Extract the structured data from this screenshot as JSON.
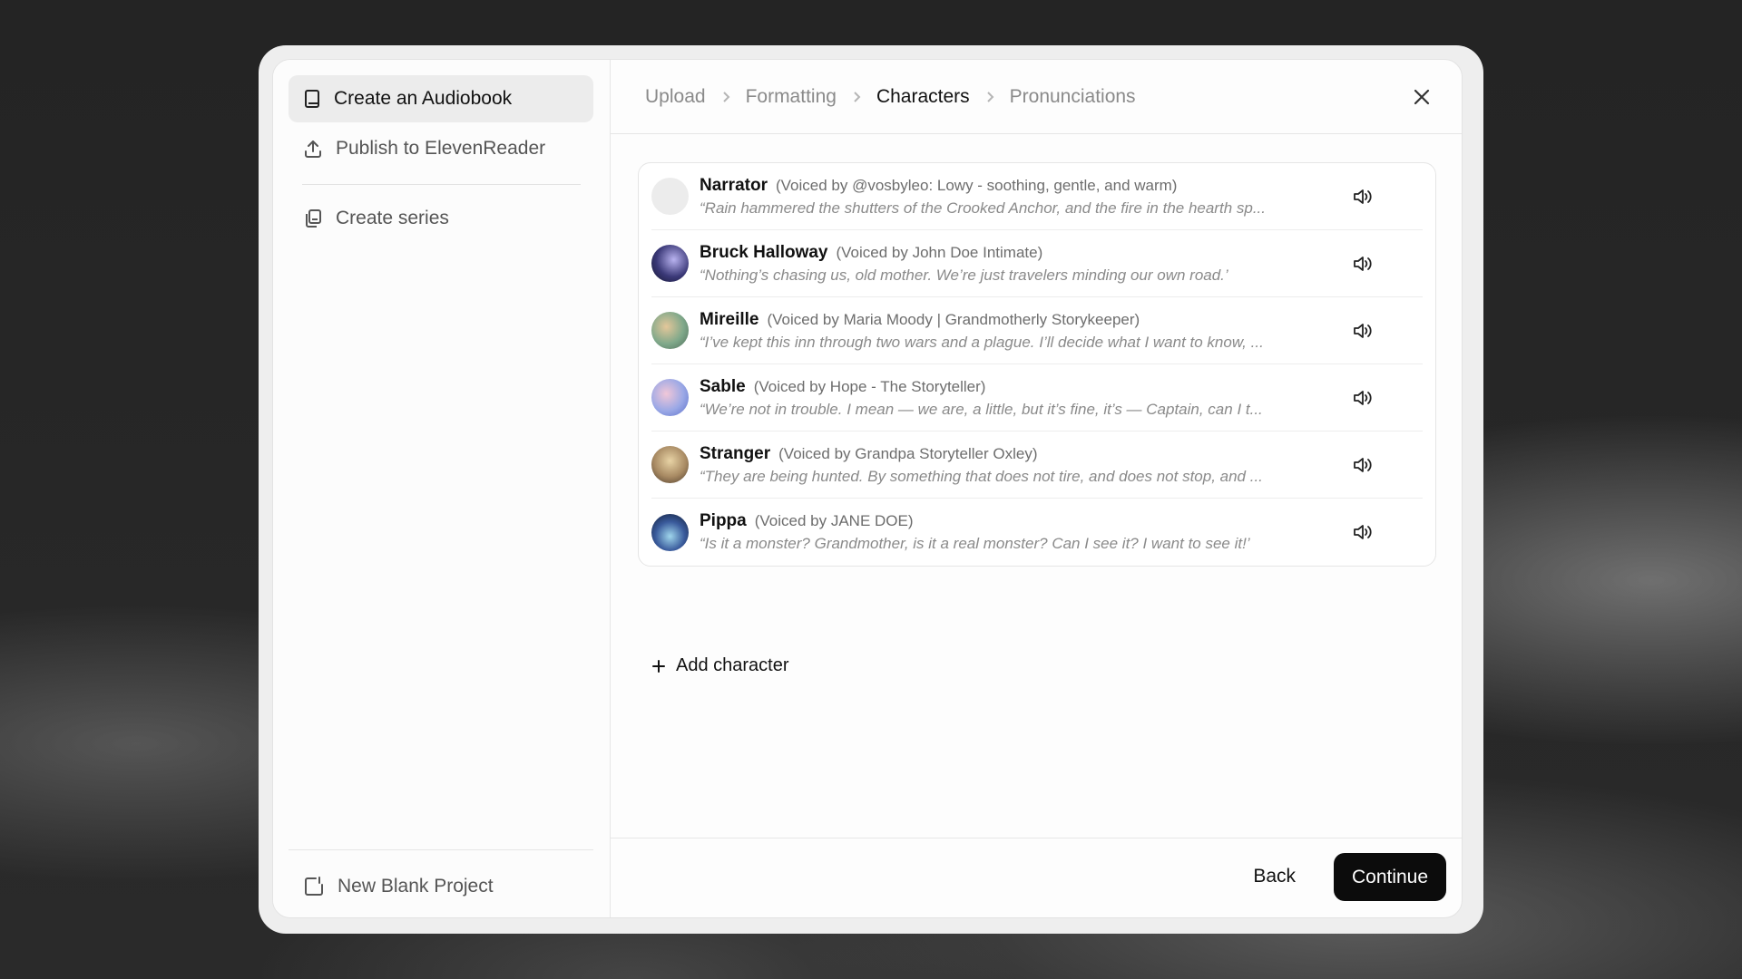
{
  "sidebar": {
    "items": [
      {
        "label": "Create an Audiobook",
        "icon": "book-icon"
      },
      {
        "label": "Publish to ElevenReader",
        "icon": "upload-icon"
      },
      {
        "label": "Create series",
        "icon": "copy-icon"
      }
    ],
    "bottom": {
      "label": "New Blank Project",
      "icon": "new-project-icon"
    }
  },
  "breadcrumb": {
    "steps": [
      "Upload",
      "Formatting",
      "Characters",
      "Pronunciations"
    ],
    "current": "Characters"
  },
  "characters": [
    {
      "name": "Narrator",
      "voice": "(Voiced by @vosbyleo: Lowy - soothing, gentle, and warm)",
      "line": "“Rain hammered the shutters of the Crooked Anchor, and the fire in the hearth sp...",
      "avatar": "#ececec"
    },
    {
      "name": "Bruck Halloway",
      "voice": "(Voiced by John Doe Intimate)",
      "line": "“Nothing’s chasing us, old mother. We’re just travelers minding our own road.’",
      "avatar": "radial-gradient(circle at 60% 40%, #b9b3f0, #3a3877 55%, #14152e)"
    },
    {
      "name": "Mireille",
      "voice": "(Voiced by Maria Moody | Grandmotherly Storykeeper)",
      "line": "“I’ve kept this inn through two wars and a plague. I’ll decide what I want to know, ...",
      "avatar": "radial-gradient(circle at 40% 40%, #e4c79a, #7fa88a 55%, #4e6b58)"
    },
    {
      "name": "Sable",
      "voice": "(Voiced by Hope - The Storyteller)",
      "line": "“We’re not in trouble. I mean — we are, a little, but it’s fine, it’s — Captain, can I t...",
      "avatar": "radial-gradient(circle at 40% 40%, #f1c7d8, #9aa8e6 55%, #5b6fc9)"
    },
    {
      "name": "Stranger",
      "voice": "(Voiced by Grandpa Storyteller Oxley)",
      "line": "“They are being hunted. By something that does not tire, and does not stop, and ...",
      "avatar": "radial-gradient(circle at 50% 40%, #e8d3a5, #a88a63 55%, #4c3a2a)"
    },
    {
      "name": "Pippa",
      "voice": "(Voiced by JANE DOE)",
      "line": "“Is it a monster? Grandmother, is it a real monster? Can I see it? I want to see it!’",
      "avatar": "radial-gradient(circle at 50% 60%, #9fd6ec, #3a5b9c 50%, #101a33)"
    }
  ],
  "add_character_label": "Add character",
  "footer": {
    "back_label": "Back",
    "continue_label": "Continue"
  }
}
